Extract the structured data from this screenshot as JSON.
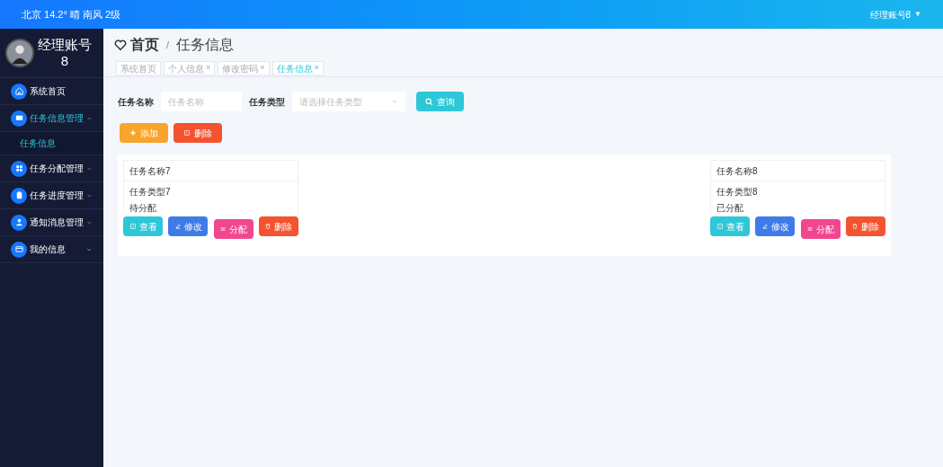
{
  "top_bar": {
    "weather": "北京  14.2°  晴  南风  2级",
    "user_menu": "经理账号8",
    "user_caret": "▼"
  },
  "sidebar": {
    "account": {
      "name": "经理账号",
      "number": "8"
    },
    "items": [
      {
        "label": "系统首页",
        "selected": false
      },
      {
        "label": "任务信息管理",
        "expanded": true,
        "selected": true,
        "children": [
          {
            "label": "任务信息",
            "selected": true
          }
        ]
      },
      {
        "label": "任务分配管理",
        "expanded": false,
        "selected": false
      },
      {
        "label": "任务进度管理",
        "expanded": false,
        "selected": false
      },
      {
        "label": "通知消息管理",
        "expanded": false,
        "selected": false
      },
      {
        "label": "我的信息",
        "expanded": false,
        "selected": false
      }
    ]
  },
  "breadcrumb": {
    "home": "首页",
    "separator": "/",
    "current": "任务信息"
  },
  "tabs": [
    {
      "label": "系统首页",
      "selected": false
    },
    {
      "label": "个人信息",
      "close": "×",
      "selected": false
    },
    {
      "label": "修改密码",
      "close": "×",
      "selected": false
    },
    {
      "label": "任务信息",
      "close": "×",
      "selected": true
    }
  ],
  "filters": [
    {
      "label": "任务名称",
      "kind": "text",
      "placeholder": "任务名称"
    },
    {
      "label": "任务类型",
      "kind": "select",
      "placeholder": "请选择任务类型"
    }
  ],
  "search_button": "查询",
  "actions": [
    {
      "label": "添加",
      "kind": "add"
    },
    {
      "label": "删除",
      "kind": "delete"
    }
  ],
  "cards": [
    {
      "title": "任务名称7",
      "type": "任务类型7",
      "status": "待分配",
      "buttons": [
        {
          "label": "查看",
          "kind": "view"
        },
        {
          "label": "修改",
          "kind": "edit"
        },
        {
          "label": "分配",
          "kind": "assign"
        },
        {
          "label": "删除",
          "kind": "delete"
        }
      ]
    },
    {
      "title": "任务名称8",
      "type": "任务类型8",
      "status": "已分配",
      "buttons": [
        {
          "label": "查看",
          "kind": "view"
        },
        {
          "label": "修改",
          "kind": "edit"
        },
        {
          "label": "分配",
          "kind": "assign"
        },
        {
          "label": "删除",
          "kind": "delete"
        }
      ]
    }
  ]
}
